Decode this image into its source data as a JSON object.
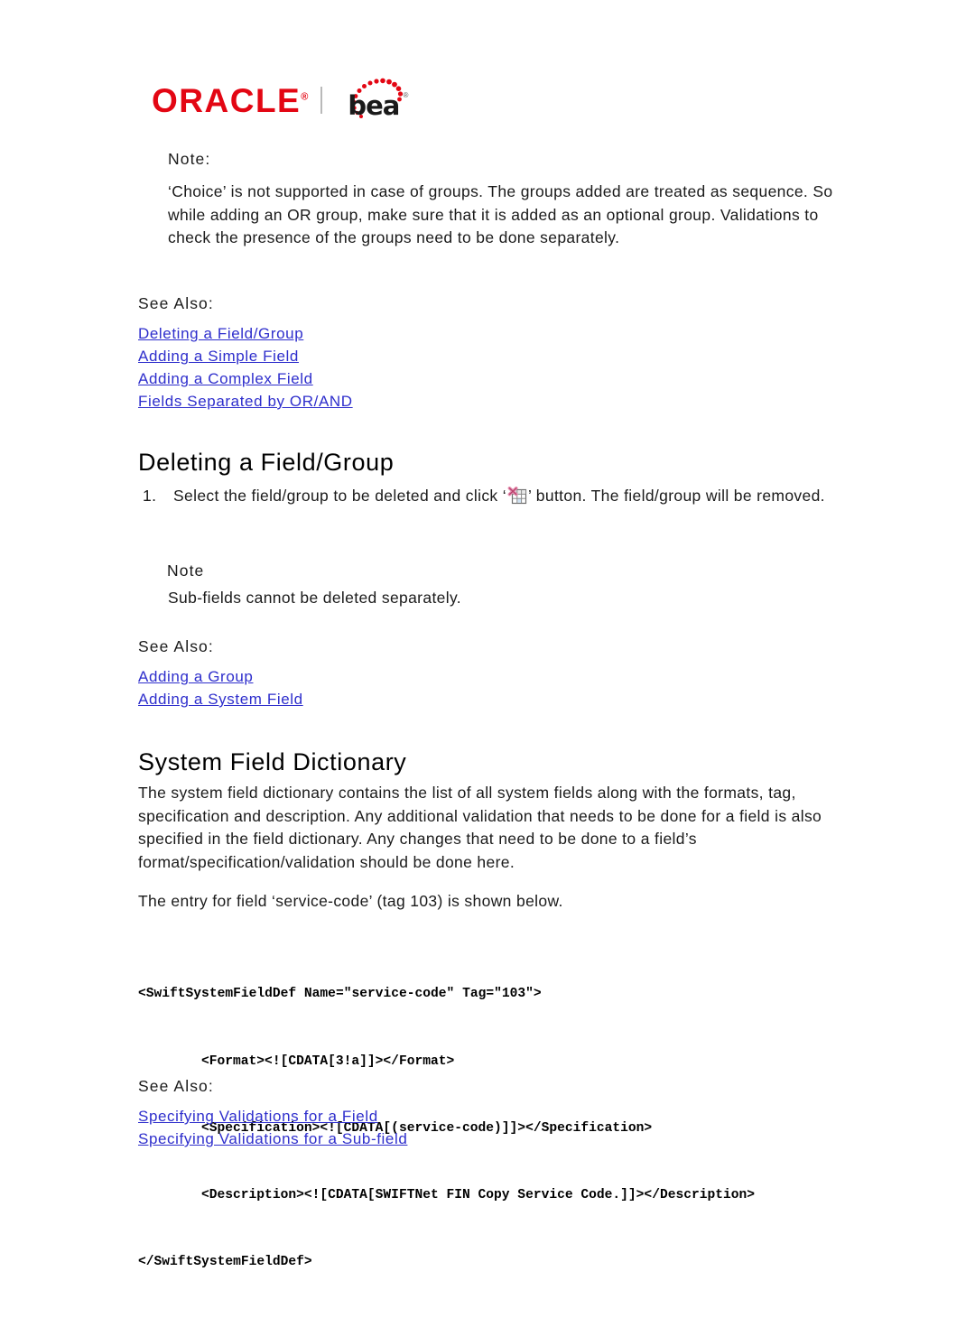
{
  "document": {
    "brand": {
      "oracle_text": "ORACLE",
      "oracle_registered": "®",
      "bea_text": "bea",
      "bea_registered": "®",
      "oracle_color": "#e30613",
      "bea_color": "#1a1a1a"
    },
    "link_color": "#2e2ecc",
    "sections": {
      "note_top": {
        "label": "Note:",
        "paragraph": "‘Choice’ is not supported in case of groups. The groups added are treated as sequence. So while adding an OR group, make sure that it is added as an optional group. Validations to check the presence of the groups need to be done separately."
      },
      "see_also_1": {
        "label": "See Also:",
        "links": [
          "Deleting a Field/Group",
          "Adding a Simple Field",
          "Adding a Complex Field",
          "Fields Separated by OR/AND"
        ]
      },
      "deleting": {
        "heading": "Deleting a Field/Group",
        "step_number": "1.",
        "step_text_before": "Select the field/group to be deleted and click ‘",
        "step_icon": "delete-grid-icon",
        "step_text_after": "’ button. The field/group will be removed.",
        "note_label": "Note",
        "note_text": "Sub-fields cannot be deleted separately."
      },
      "see_also_2": {
        "label": "See Also:",
        "links": [
          "Adding a Group",
          "Adding a System Field"
        ]
      },
      "dictionary": {
        "heading": "System Field Dictionary",
        "paragraph": "The system field dictionary contains the list of all system fields along with the formats, tag, specification and description. Any additional validation that needs to be done for a field is also specified in the field dictionary. Any changes that need to be done to a field’s format/specification/validation should be done here.",
        "entry_intro": "The entry for field ‘service-code’ (tag 103) is shown below.",
        "code": {
          "line1": "<SwiftSystemFieldDef Name=\"service-code\" Tag=\"103\">",
          "line2": "<Format><![CDATA[3!a]]></Format>",
          "line3": "<Specification><![CDATA[(service-code)]]></Specification>",
          "line4": "<Description><![CDATA[SWIFTNet FIN Copy Service Code.]]></Description>",
          "line5": "</SwiftSystemFieldDef>"
        }
      },
      "see_also_3": {
        "label": "See Also:",
        "links": [
          "Specifying Validations for a Field",
          "Specifying Validations for a Sub-field"
        ]
      }
    }
  }
}
